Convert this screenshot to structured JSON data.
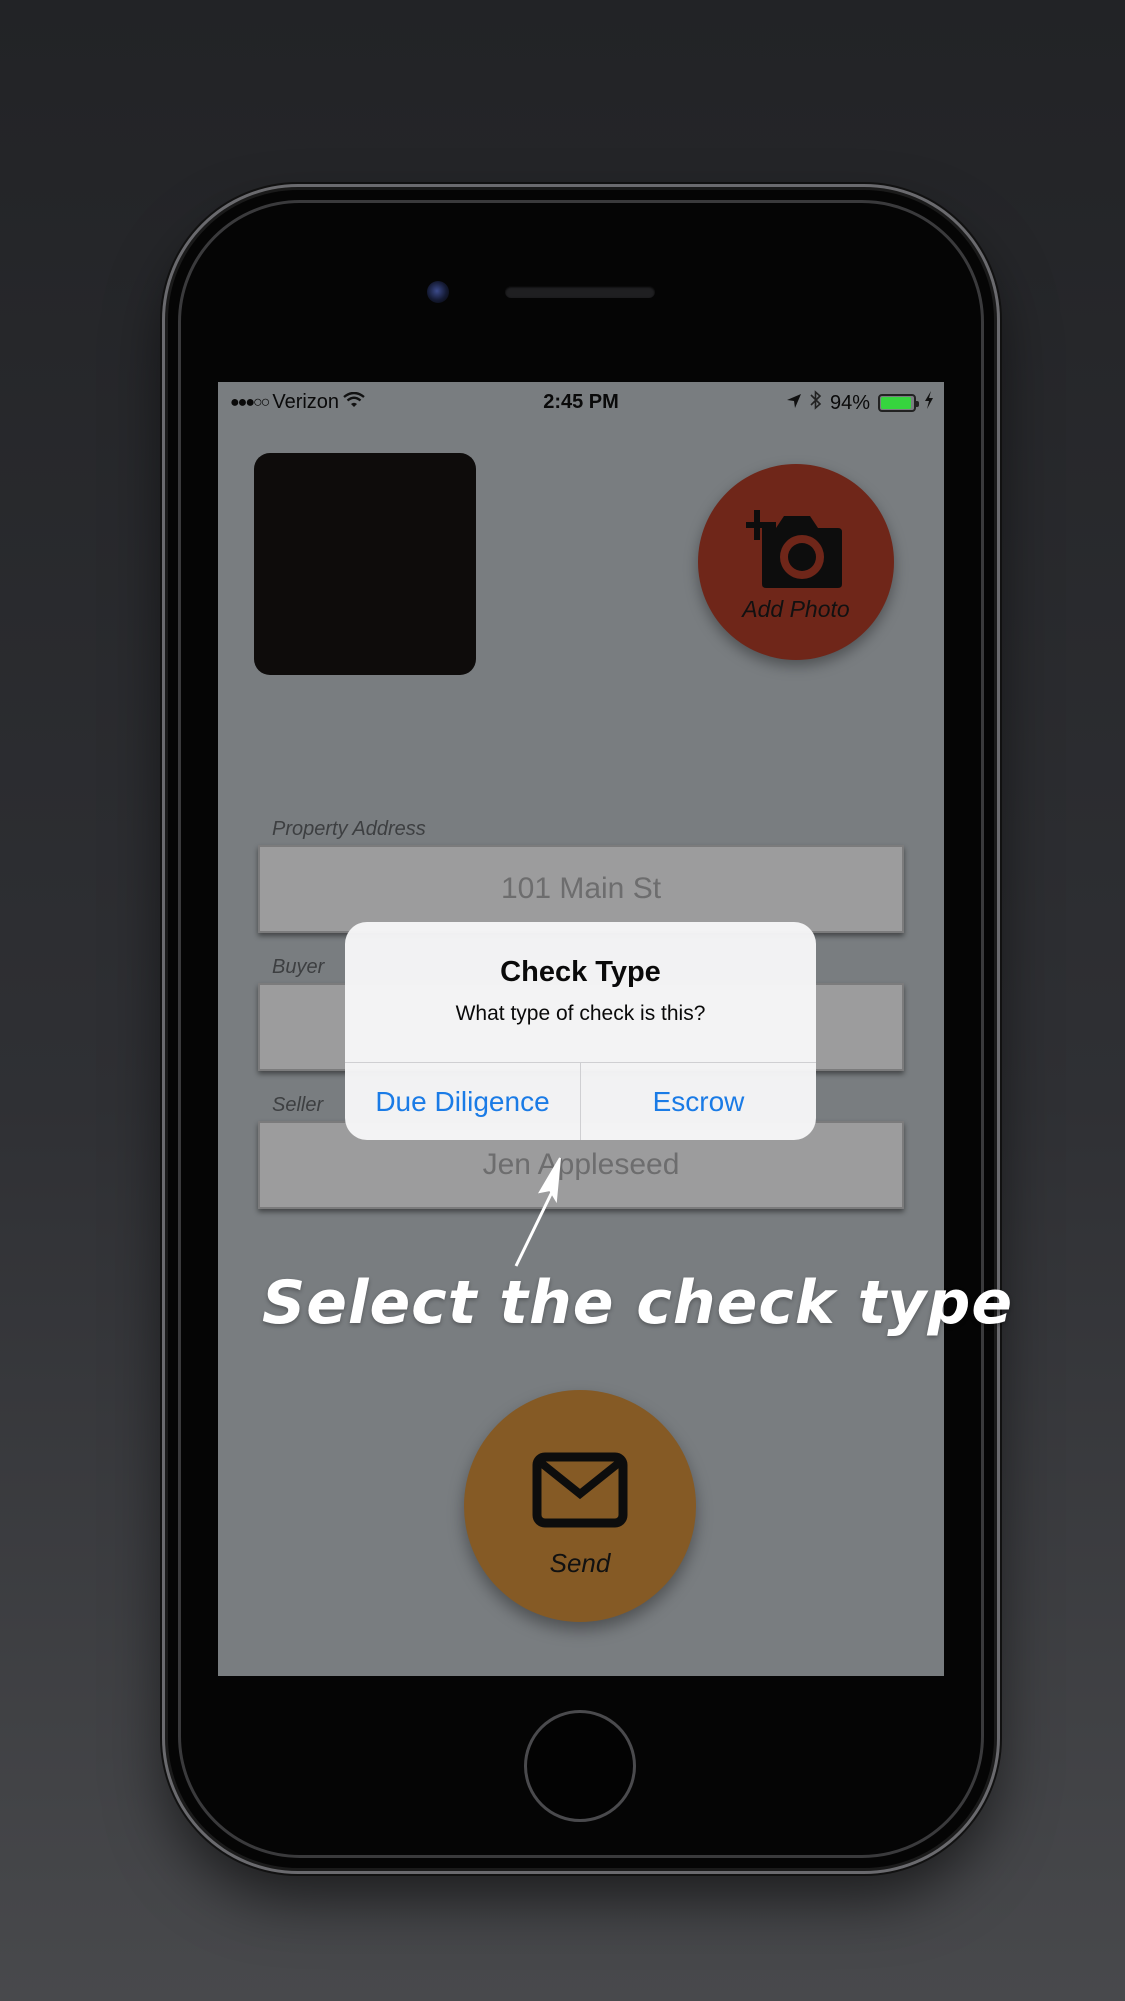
{
  "status_bar": {
    "signal": "●●●○○",
    "carrier": "Verizon",
    "time": "2:45 PM",
    "battery": "94%",
    "battery_level": 0.94
  },
  "add_photo_label": "Add Photo",
  "fields": {
    "property_address": {
      "label": "Property Address",
      "value": "101 Main St"
    },
    "buyer": {
      "label": "Buyer",
      "value": ""
    },
    "seller": {
      "label": "Seller",
      "value": "Jen Appleseed"
    }
  },
  "send_label": "Send",
  "alert": {
    "title": "Check Type",
    "message": "What type of check is this?",
    "buttons": [
      "Due Diligence",
      "Escrow"
    ]
  },
  "callout": "Select the check type",
  "colors": {
    "alert_button": "#1a7be6",
    "add_photo": "#6f2619",
    "send": "#855a25",
    "battery": "#36d43e"
  },
  "icons": {
    "wifi": "wifi-icon",
    "location": "location-arrow-icon",
    "bluetooth": "bluetooth-icon",
    "charging": "charging-bolt-icon",
    "camera": "camera-plus-icon",
    "send": "envelope-icon"
  }
}
